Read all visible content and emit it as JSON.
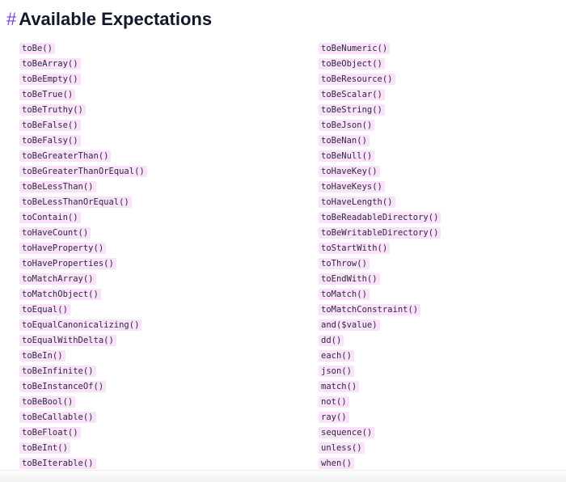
{
  "heading": {
    "anchor": "#",
    "title": "Available Expectations"
  },
  "left_column": [
    "toBe()",
    "toBeArray()",
    "toBeEmpty()",
    "toBeTrue()",
    "toBeTruthy()",
    "toBeFalse()",
    "toBeFalsy()",
    "toBeGreaterThan()",
    "toBeGreaterThanOrEqual()",
    "toBeLessThan()",
    "toBeLessThanOrEqual()",
    "toContain()",
    "toHaveCount()",
    "toHaveProperty()",
    "toHaveProperties()",
    "toMatchArray()",
    "toMatchObject()",
    "toEqual()",
    "toEqualCanonicalizing()",
    "toEqualWithDelta()",
    "toBeIn()",
    "toBeInfinite()",
    "toBeInstanceOf()",
    "toBeBool()",
    "toBeCallable()",
    "toBeFloat()",
    "toBeInt()",
    "toBeIterable()"
  ],
  "right_column": [
    "toBeNumeric()",
    "toBeObject()",
    "toBeResource()",
    "toBeScalar()",
    "toBeString()",
    "toBeJson()",
    "toBeNan()",
    "toBeNull()",
    "toHaveKey()",
    "toHaveKeys()",
    "toHaveLength()",
    "toBeReadableDirectory()",
    "toBeWritableDirectory()",
    "toStartWith()",
    "toThrow()",
    "toEndWith()",
    "toMatch()",
    "toMatchConstraint()",
    "and($value)",
    "dd()",
    "each()",
    "json()",
    "match()",
    "not()",
    "ray()",
    "sequence()",
    "unless()",
    "when()"
  ],
  "colors": {
    "anchor": "#7c3aed",
    "code_background": "#fbe2fb",
    "heading_text": "#111827"
  }
}
